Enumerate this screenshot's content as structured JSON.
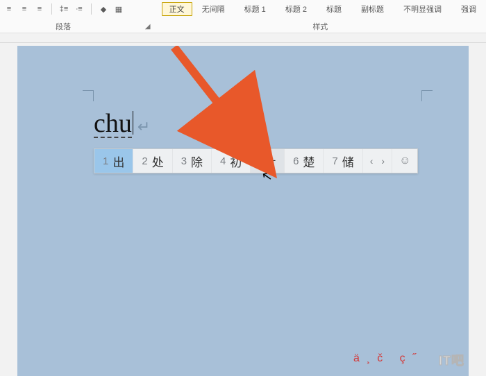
{
  "ribbon": {
    "paragraph_group_label": "段落",
    "styles_group_label": "样式",
    "align_left_icon": "≡",
    "align_center_icon": "≡",
    "align_right_icon": "≡",
    "line_spacing_icon": "‡≡",
    "bullets_icon": "∙≡",
    "indent_icon": "➤",
    "fill_icon": "◆",
    "borders_icon": "▦"
  },
  "styles": {
    "items": [
      {
        "label": "正文",
        "current": true
      },
      {
        "label": "无间隔"
      },
      {
        "label": "标题 1"
      },
      {
        "label": "标题 2"
      },
      {
        "label": "标题"
      },
      {
        "label": "副标题"
      },
      {
        "label": "不明显强调"
      },
      {
        "label": "强调"
      }
    ]
  },
  "document": {
    "typed_text": "chu",
    "paragraph_mark": "↵"
  },
  "ime": {
    "candidates": [
      {
        "n": "1",
        "ch": "出",
        "state": "selected"
      },
      {
        "n": "2",
        "ch": "处"
      },
      {
        "n": "3",
        "ch": "除"
      },
      {
        "n": "4",
        "ch": "初"
      },
      {
        "n": "5",
        "ch": "÷",
        "state": "hover"
      },
      {
        "n": "6",
        "ch": "楚"
      },
      {
        "n": "7",
        "ch": "储"
      }
    ],
    "prev": "‹",
    "next": "›",
    "emoji": "☺"
  },
  "annotation": {
    "arrow_color": "#e8582a"
  },
  "footer": {
    "diacritics": "ä¸č ç˝",
    "watermark": "IT吧"
  }
}
